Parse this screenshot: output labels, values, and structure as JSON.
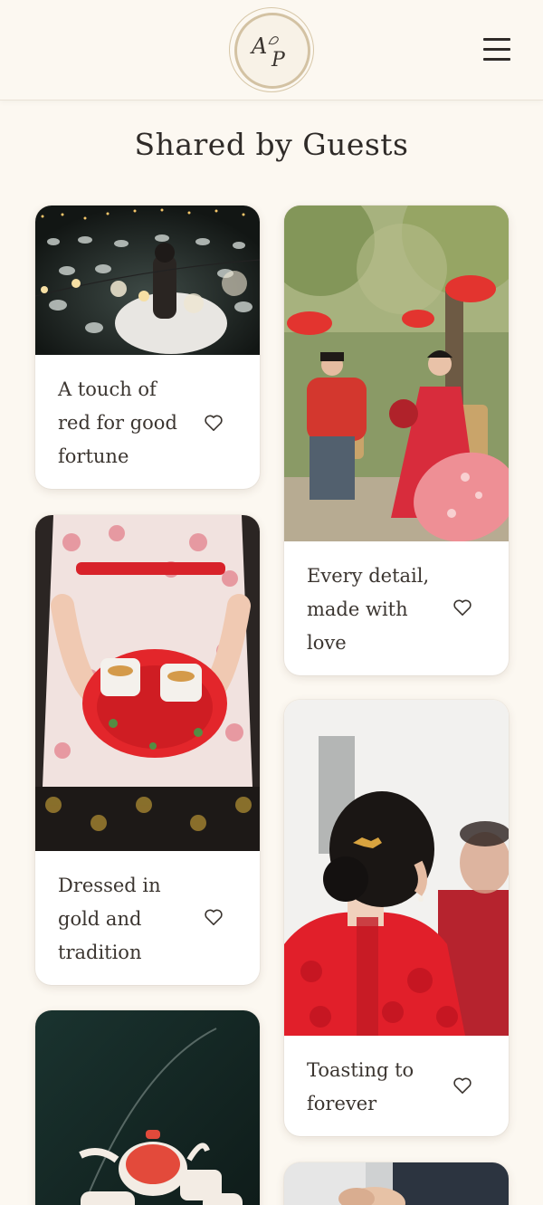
{
  "header": {
    "logo_monogram": "AP",
    "logo_letter_1": "A",
    "logo_letter_2": "P",
    "menu_icon": "hamburger-menu-icon"
  },
  "page": {
    "title": "Shared by Guests"
  },
  "gallery": {
    "cards": [
      {
        "caption": "A touch of red for good fortune",
        "photo": "couple under string lights at night",
        "icon": "heart-icon"
      },
      {
        "caption": "Every detail, made with love",
        "photo": "couple seated under red lanterns",
        "icon": "heart-icon"
      },
      {
        "caption": "Dressed in gold and tradition",
        "photo": "hands holding red tea tray",
        "icon": "heart-icon"
      },
      {
        "caption": "Toasting to forever",
        "photo": "bride with gold hairpin",
        "icon": "heart-icon"
      },
      {
        "caption": "",
        "photo": "red porcelain tea set",
        "icon": "heart-icon"
      },
      {
        "caption": "",
        "photo": "holding hands",
        "icon": "heart-icon"
      }
    ]
  },
  "colors": {
    "background": "#fcf8f1",
    "card": "#ffffff",
    "text": "#3b3530",
    "logo_ring": "#d3c2a3",
    "accent_red": "#d8262c"
  }
}
